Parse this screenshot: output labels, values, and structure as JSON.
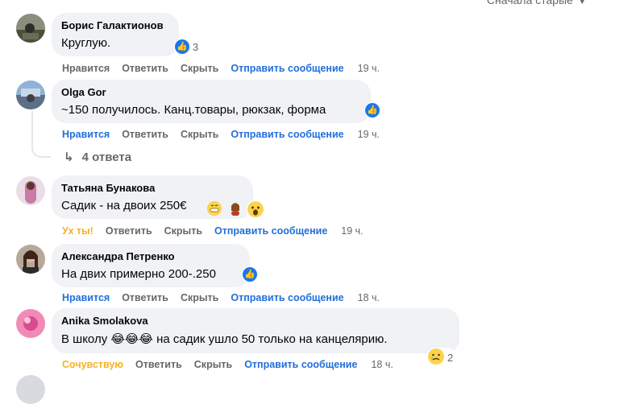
{
  "sort_label": "Сначала старые",
  "comments": [
    {
      "author": "Борис Галактионов",
      "text": "Круглую.",
      "reaction_count": "3",
      "actions": {
        "like": "Нравится",
        "reply": "Ответить",
        "hide": "Скрыть",
        "message": "Отправить сообщение",
        "time": "19 ч."
      }
    },
    {
      "author": "Olga Gor",
      "text": "~150 получилось. Канц.товары, рюкзак, форма",
      "actions": {
        "like": "Нравится",
        "reply": "Ответить",
        "hide": "Скрыть",
        "message": "Отправить сообщение",
        "time": "19 ч."
      },
      "replies_label": "4 ответа"
    },
    {
      "author": "Татьяна Бунакова",
      "text": "Садик - на двоих 250€",
      "actions": {
        "like": "Ух ты!",
        "reply": "Ответить",
        "hide": "Скрыть",
        "message": "Отправить сообщение",
        "time": "19 ч."
      }
    },
    {
      "author": "Александра Петренко",
      "text": "На двих примерно 200-.250",
      "actions": {
        "like": "Нравится",
        "reply": "Ответить",
        "hide": "Скрыть",
        "message": "Отправить сообщение",
        "time": "18 ч."
      }
    },
    {
      "author": "Anika Smolakova",
      "text": "В школу 😂😂😂 на садик ушло 50 только на канцелярию.",
      "reaction_count": "2",
      "actions": {
        "like": "Сочувствую",
        "reply": "Ответить",
        "hide": "Скрыть",
        "message": "Отправить сообщение",
        "time": "18 ч."
      }
    }
  ],
  "colors": {
    "bubble": "#f0f2f5",
    "link": "#216fdb",
    "muted": "#65676b",
    "like_blue": "#1877f2",
    "emoji_yellow": "#fcd34d"
  }
}
